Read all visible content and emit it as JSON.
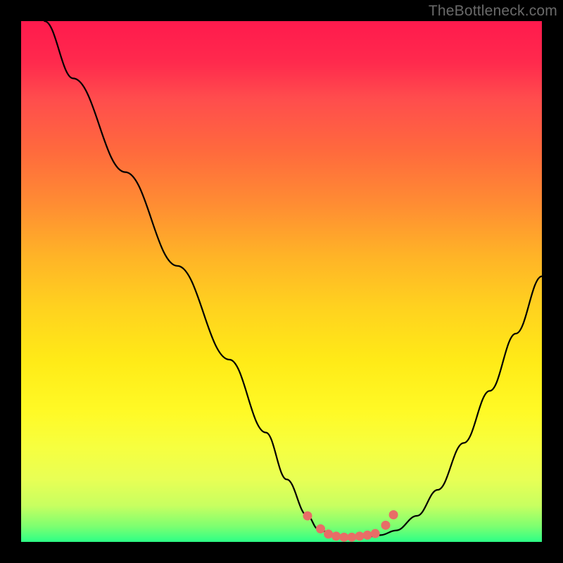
{
  "watermark": "TheBottleneck.com",
  "chart_data": {
    "type": "line",
    "title": "",
    "xlabel": "",
    "ylabel": "",
    "xlim": [
      0,
      100
    ],
    "ylim": [
      0,
      100
    ],
    "series": [
      {
        "name": "curve",
        "x": [
          4.5,
          10,
          20,
          30,
          40,
          47,
          51,
          55,
          57,
          60,
          63,
          66,
          69,
          72,
          76,
          80,
          85,
          90,
          95,
          100
        ],
        "y": [
          100,
          89,
          71,
          53,
          35,
          21,
          12,
          5,
          2.5,
          1.2,
          0.8,
          0.9,
          1.3,
          2.2,
          5,
          10,
          19,
          29,
          40,
          51
        ]
      }
    ],
    "markers": {
      "name": "sweet-spot-dots",
      "color": "#e86d67",
      "points": [
        {
          "x": 55.0,
          "y": 5.0
        },
        {
          "x": 57.5,
          "y": 2.5
        },
        {
          "x": 59.0,
          "y": 1.5
        },
        {
          "x": 60.5,
          "y": 1.1
        },
        {
          "x": 62.0,
          "y": 0.9
        },
        {
          "x": 63.5,
          "y": 0.9
        },
        {
          "x": 65.0,
          "y": 1.1
        },
        {
          "x": 66.5,
          "y": 1.3
        },
        {
          "x": 68.0,
          "y": 1.6
        },
        {
          "x": 70.0,
          "y": 3.2
        },
        {
          "x": 71.5,
          "y": 5.2
        }
      ]
    }
  }
}
